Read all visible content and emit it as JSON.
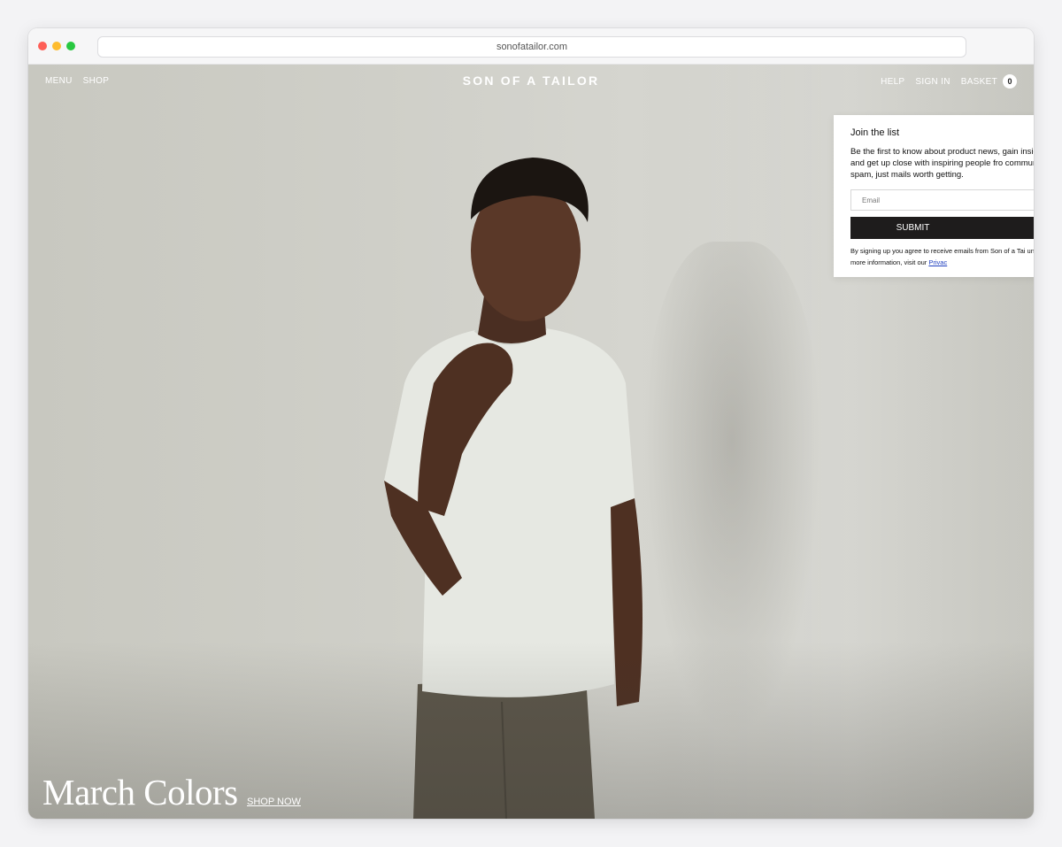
{
  "browser": {
    "url": "sonofatailor.com"
  },
  "nav": {
    "left": [
      {
        "label": "MENU"
      },
      {
        "label": "SHOP"
      }
    ],
    "logo": "SON OF A TAILOR",
    "right": [
      {
        "label": "HELP"
      },
      {
        "label": "SIGN IN"
      }
    ],
    "basket_label": "BASKET",
    "basket_count": "0"
  },
  "popup": {
    "title": "Join the list",
    "body": "Be the first to know about product news, gain insig scenes, and get up close with inspiring people fro community. No spam, just mails worth getting.",
    "email_placeholder": "Email",
    "submit_label": "SUBMIT",
    "legal_text": "By signing up you agree to receive emails from Son of a Tai unsubscribe any time. For more information, visit our ",
    "privacy_link": "Privac"
  },
  "hero": {
    "headline": "March Colors",
    "cta": "SHOP NOW"
  },
  "colors": {
    "submit_bg": "#1e1c1c",
    "backdrop": "#cfcfc8"
  }
}
